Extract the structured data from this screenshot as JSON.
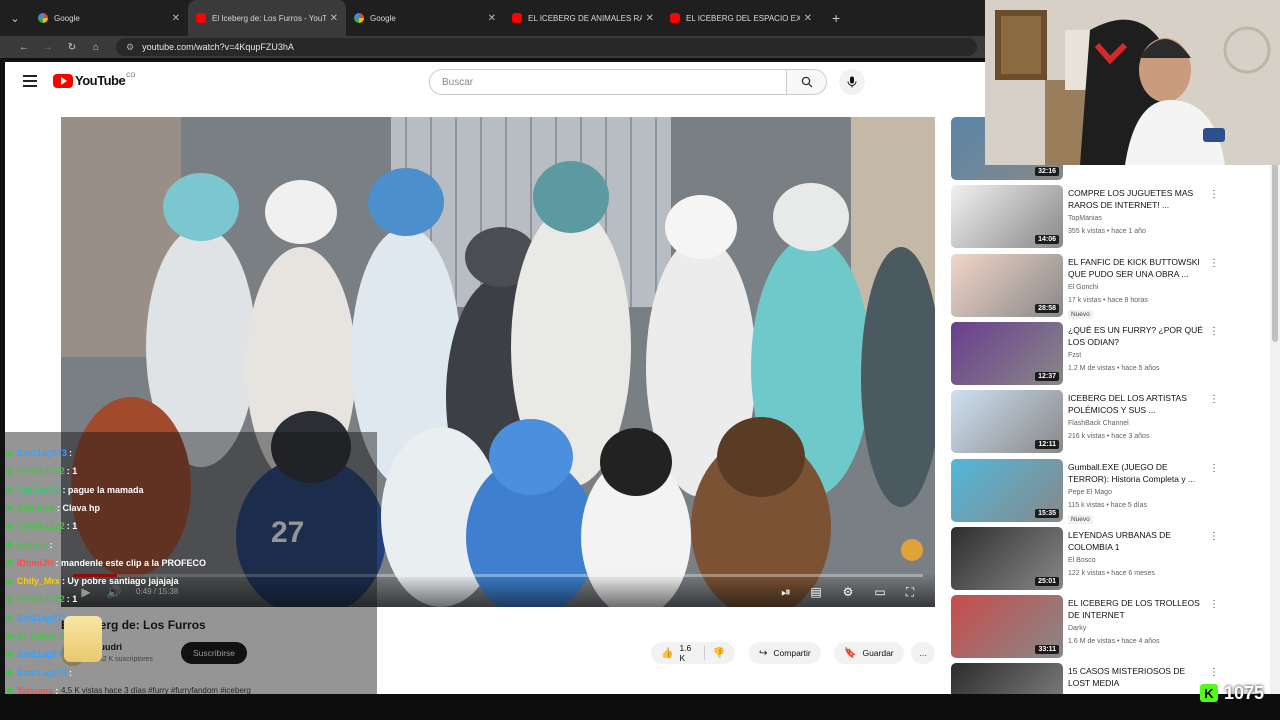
{
  "browser": {
    "tabs": [
      {
        "label": "Google",
        "favicon": "google-icon",
        "active": false
      },
      {
        "label": "El Iceberg de: Los Furros - YouT",
        "favicon": "youtube-icon",
        "active": true
      },
      {
        "label": "Google",
        "favicon": "google-icon",
        "active": false
      },
      {
        "label": "EL ICEBERG DE ANIMALES RAR",
        "favicon": "youtube-icon",
        "active": false
      },
      {
        "label": "EL ICEBERG DEL ESPACIO EXPLI",
        "favicon": "youtube-icon",
        "active": false
      }
    ],
    "url": "youtube.com/watch?v=4KqupFZU3hA"
  },
  "youtube": {
    "logo_text": "YouTube",
    "logo_country": "CO",
    "search_placeholder": "Buscar",
    "player": {
      "timecode": "0:49 / 15:38",
      "progress_fraction": 0.052
    },
    "video": {
      "title": "El Iceberg de: Los Furros",
      "channel": "Duudri",
      "subscribers": "1.52 K suscriptores",
      "subscribe_label": "Suscribirse",
      "likes": "1.6 K",
      "share_label": "Compartir",
      "save_label": "Guardar",
      "more_label": "…",
      "description": "4,5 K vistas  hace 3 días  #furry #furryfandom #iceberg"
    },
    "recommendations": [
      {
        "title": "",
        "channel": "",
        "meta": "",
        "duration": "32:16",
        "new": ""
      },
      {
        "title": "COMPRE LOS JUGUETES MAS RAROS DE INTERNET! ...",
        "channel": "TopManias",
        "meta": "355 k vistas • hace 1 año",
        "duration": "14:06",
        "new": ""
      },
      {
        "title": "EL FANFIC DE KICK BUTTOWSKI QUE PUDO SER UNA OBRA ...",
        "channel": "El Gonchi",
        "meta": "17 k vistas • hace 8 horas",
        "duration": "28:58",
        "new": "Nuevo"
      },
      {
        "title": "¿QUÉ ES UN FURRY? ¿POR QUÉ LOS ODIAN?",
        "channel": "Fzst",
        "meta": "1.2 M de vistas • hace 5 años",
        "duration": "12:37",
        "new": ""
      },
      {
        "title": "ICEBERG DEL LOS ARTISTAS POLÉMICOS Y SUS ...",
        "channel": "FlashBack Channel",
        "meta": "216 k vistas • hace 3 años",
        "duration": "12:11",
        "new": ""
      },
      {
        "title": "Gumball.EXE (JUEGO DE TERROR): Historia Completa y ...",
        "channel": "Pepe El Mago",
        "meta": "115 k vistas • hace 5 días",
        "duration": "15:35",
        "new": "Nuevo"
      },
      {
        "title": "LEYENDAS URBANAS DE COLOMBIA 1",
        "channel": "El Bosco",
        "meta": "122 k vistas • hace 6 meses",
        "duration": "25:01",
        "new": ""
      },
      {
        "title": "EL ICEBERG DE LOS TROLLEOS DE INTERNET",
        "channel": "Darky",
        "meta": "1.6 M de vistas • hace 4 años",
        "duration": "33:11",
        "new": ""
      },
      {
        "title": "15 CASOS MISTERIOSOS DE LOST MEDIA",
        "channel": "",
        "meta": "",
        "duration": "",
        "new": ""
      }
    ]
  },
  "chat": {
    "lines": [
      {
        "user": "Sant1ag073",
        "msg": ":",
        "color": "#3aa0ff"
      },
      {
        "user": "Yordin1222",
        "msg": ": 1",
        "color": "#47c447"
      },
      {
        "user": "YesGorRT",
        "msg": ": pague la mamada",
        "color": "#2ecc71"
      },
      {
        "user": "XRemick",
        "msg": ": Clava hp",
        "color": "#47c447"
      },
      {
        "user": "Yordin1222",
        "msg": ": 1",
        "color": "#47c447"
      },
      {
        "user": "kaboza",
        "msg": ":",
        "color": "#47c447"
      },
      {
        "user": "iDomiJH",
        "msg": ": mandenle este clip a la PROFECO",
        "color": "#ff4d4d"
      },
      {
        "user": "Chily_Mrx",
        "msg": ": Uy pobre santiago jajajaja",
        "color": "#ffcc00"
      },
      {
        "user": "Yordin1222",
        "msg": ": 1",
        "color": "#47c447"
      },
      {
        "user": "Sant1ag073",
        "msg": ":",
        "color": "#3aa0ff"
      },
      {
        "user": "El_Saitro_508",
        "msg": ":",
        "color": "#47c447"
      },
      {
        "user": "Sant1ag073",
        "msg": ":",
        "color": "#3aa0ff"
      },
      {
        "user": "Sant1ag073",
        "msg": ":",
        "color": "#3aa0ff"
      },
      {
        "user": "Tatsuma",
        "msg": ":",
        "color": "#ff4d4d"
      }
    ]
  },
  "kick": {
    "logo": "K",
    "viewer_count": "1075"
  }
}
